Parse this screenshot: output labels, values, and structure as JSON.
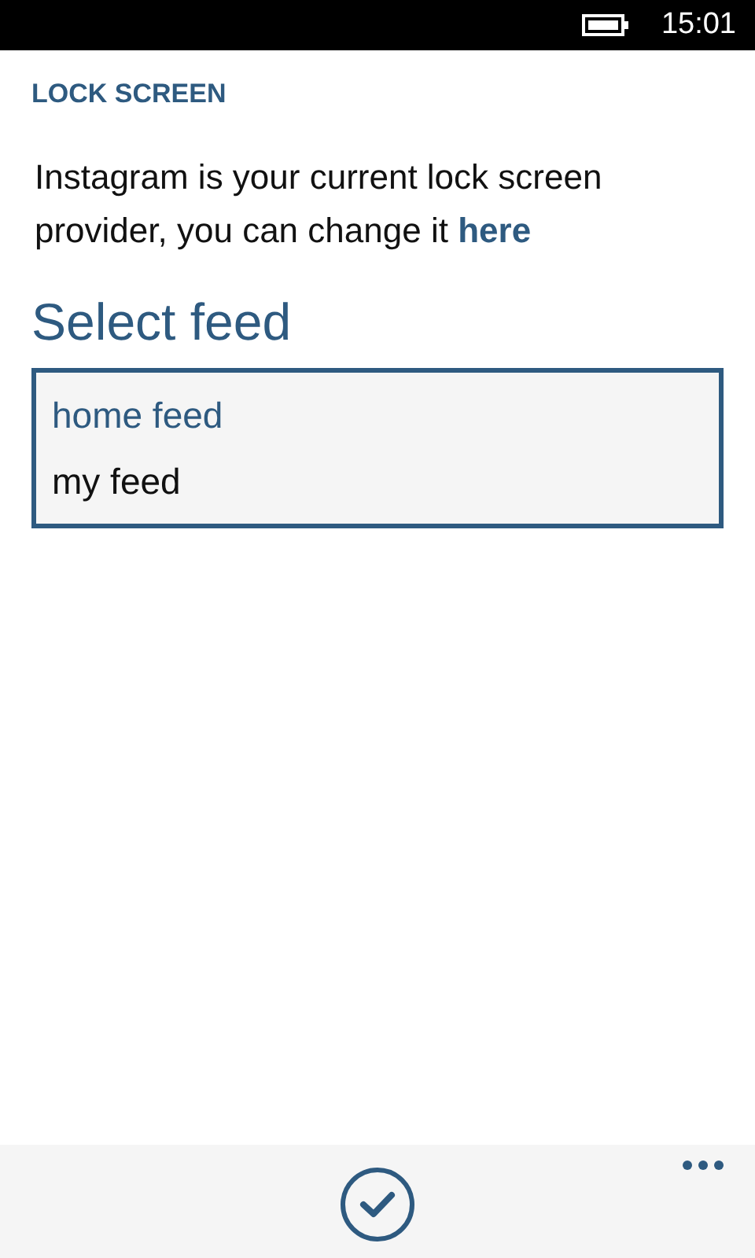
{
  "status_bar": {
    "time": "15:01"
  },
  "page_title": "LOCK SCREEN",
  "description": "Instagram is your current lock screen provider, you can change it",
  "link": "here",
  "feed_picker": {
    "label": "Select feed",
    "options": [
      {
        "label": "home feed",
        "selected": true
      },
      {
        "label": "my feed",
        "selected": false
      }
    ]
  }
}
